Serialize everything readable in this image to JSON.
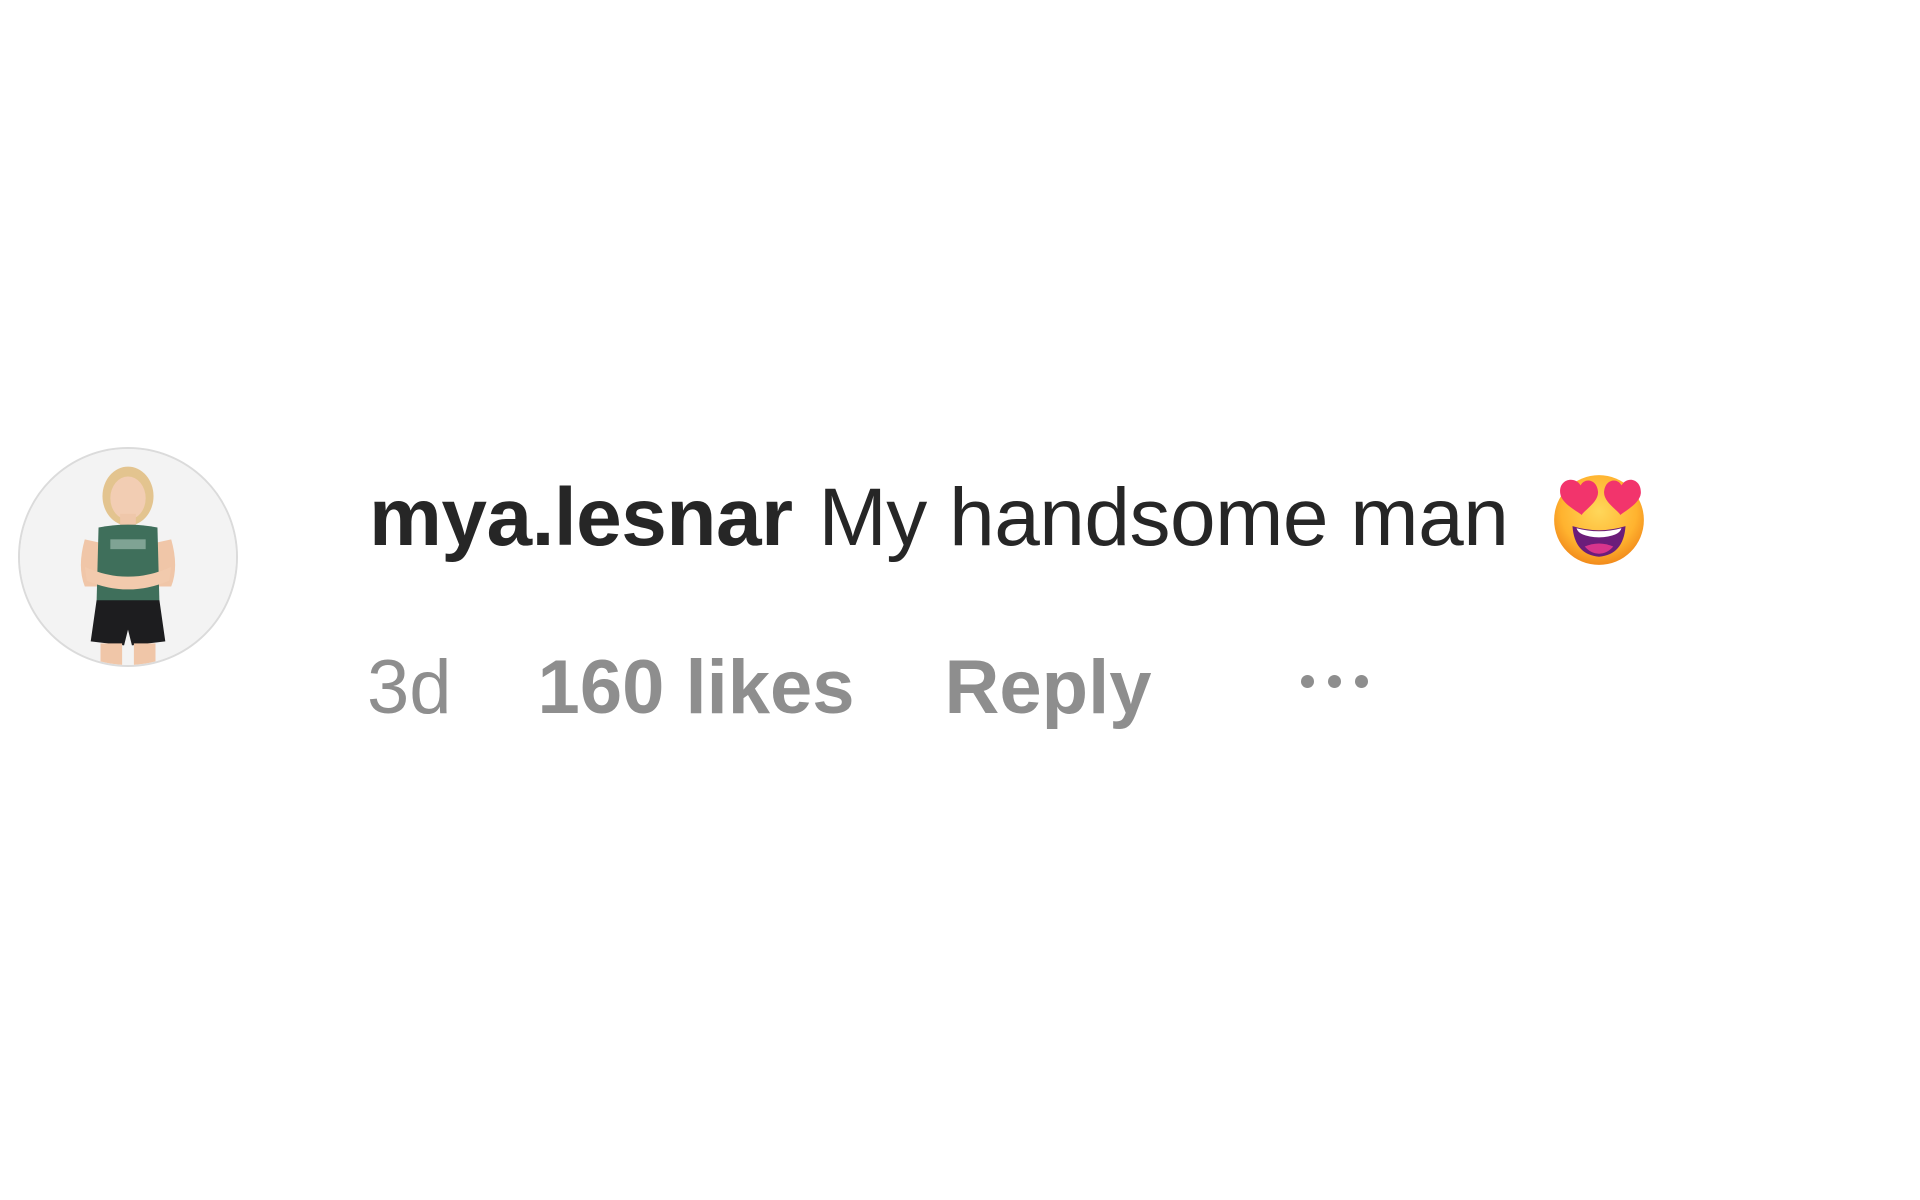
{
  "comment": {
    "username": "mya.lesnar",
    "text": "My handsome man",
    "emoji_icon": "smiling-face-with-heart-eyes-icon",
    "avatar_icon": "profile-photo-avatar",
    "meta": {
      "time": "3d",
      "likes": "160 likes",
      "reply_label": "Reply",
      "more_icon": "more-options-icon"
    }
  },
  "colors": {
    "background": "#ffffff",
    "primary_text": "#262626",
    "secondary_text": "#8e8e8e"
  }
}
